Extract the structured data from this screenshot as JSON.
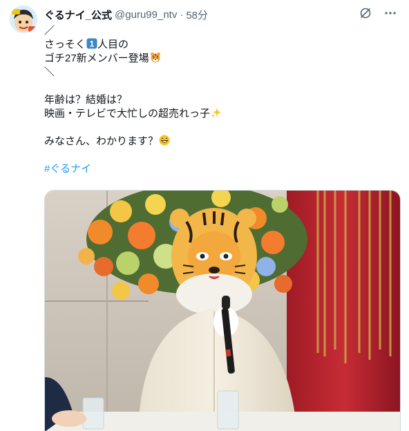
{
  "author": {
    "name": "ぐるナイ_公式",
    "handle": "@guru99_ntv",
    "separator": "·",
    "time": "58分"
  },
  "tweet": {
    "lines": [
      "／",
      "さっそく",
      "人目の",
      "ゴチ27新メンバー登場",
      "＼",
      "年齢は？結婚は？",
      "映画・テレビで大忙しの超売れっ子",
      "みなさん、わかります？",
      "#ぐるナイ"
    ],
    "keycap_number": "1"
  },
  "icons": {
    "grok": "grok-icon",
    "more": "more-icon",
    "tiger_emoji": "tiger-face-emoji",
    "sparkles": "sparkles-emoji",
    "grin": "grinning-face-emoji"
  },
  "colors": {
    "link": "#1d9bf0",
    "text": "#0f1419",
    "muted": "#536471"
  }
}
